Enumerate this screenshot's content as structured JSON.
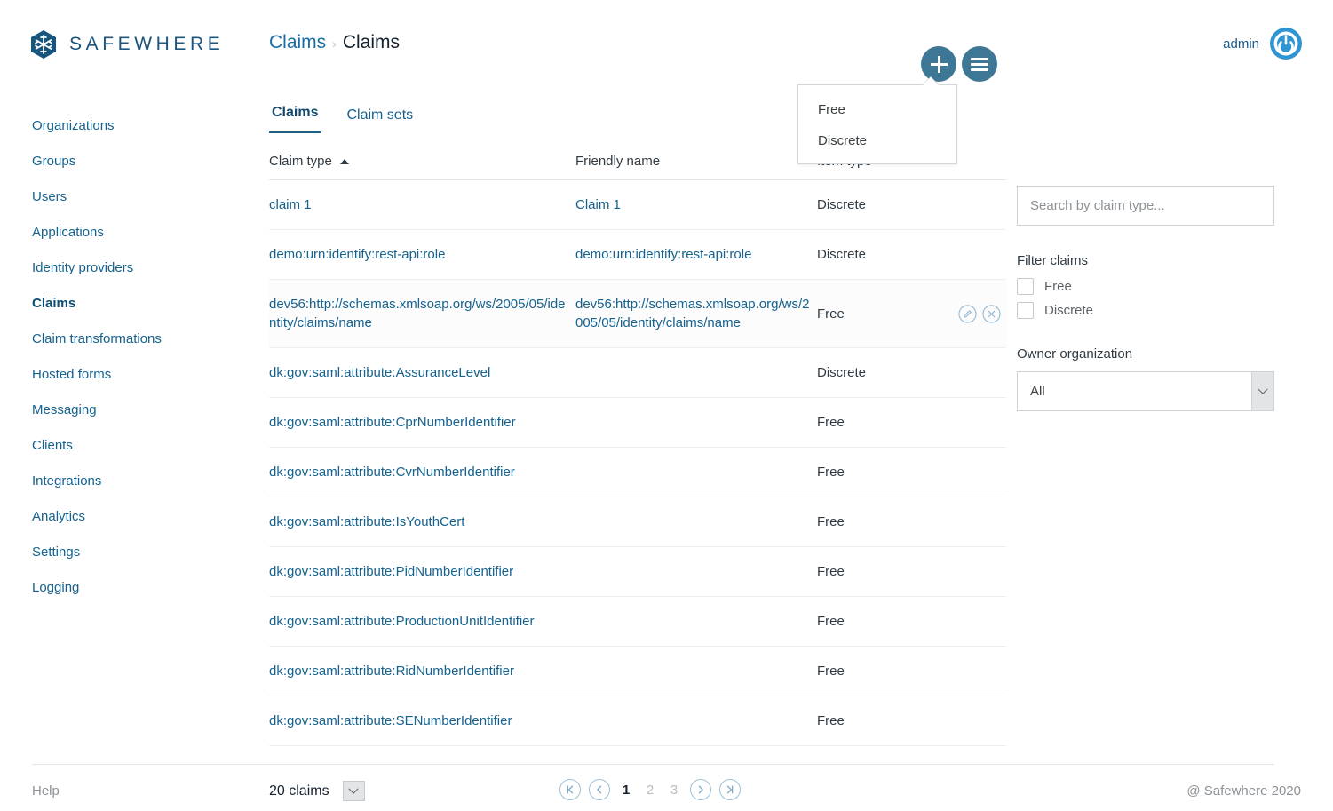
{
  "brand": {
    "name": "SAFEWHERE",
    "logo_icon": "snowflake-hexagon-logo",
    "color": "#1c567f"
  },
  "breadcrumb": {
    "parent": "Claims",
    "separator": "›",
    "current": "Claims"
  },
  "header": {
    "add_button_icon": "plus-icon",
    "menu_button_icon": "hamburger-menu-icon",
    "admin_label": "admin",
    "avatar_icon": "power-avatar-icon"
  },
  "add_menu": {
    "items": [
      {
        "label": "Free"
      },
      {
        "label": "Discrete"
      }
    ]
  },
  "sidebar": {
    "items": [
      {
        "label": "Organizations",
        "active": false
      },
      {
        "label": "Groups",
        "active": false
      },
      {
        "label": "Users",
        "active": false
      },
      {
        "label": "Applications",
        "active": false
      },
      {
        "label": "Identity providers",
        "active": false
      },
      {
        "label": "Claims",
        "active": true
      },
      {
        "label": "Claim transformations",
        "active": false
      },
      {
        "label": "Hosted forms",
        "active": false
      },
      {
        "label": "Messaging",
        "active": false
      },
      {
        "label": "Clients",
        "active": false
      },
      {
        "label": "Integrations",
        "active": false
      },
      {
        "label": "Analytics",
        "active": false
      },
      {
        "label": "Settings",
        "active": false
      },
      {
        "label": "Logging",
        "active": false
      }
    ]
  },
  "tabs": [
    {
      "label": "Claims",
      "active": true
    },
    {
      "label": "Claim sets",
      "active": false
    }
  ],
  "table": {
    "columns": [
      {
        "label": "Claim type",
        "sort": "asc",
        "sort_icon": "sort-ascending-icon"
      },
      {
        "label": "Friendly name"
      },
      {
        "label": "Item type"
      },
      {
        "label": ""
      }
    ],
    "rows": [
      {
        "claim_type": "claim 1",
        "friendly_name": "Claim 1",
        "item_type": "Discrete",
        "hovered": false
      },
      {
        "claim_type": "demo:urn:identify:rest-api:role",
        "friendly_name": "demo:urn:identify:rest-api:role",
        "item_type": "Discrete",
        "hovered": false
      },
      {
        "claim_type": "dev56:http://schemas.xmlsoap.org/ws/2005/05/identity/claims/name",
        "friendly_name": "dev56:http://schemas.xmlsoap.org/ws/2005/05/identity/claims/name",
        "item_type": "Free",
        "hovered": true
      },
      {
        "claim_type": "dk:gov:saml:attribute:AssuranceLevel",
        "friendly_name": "",
        "item_type": "Discrete",
        "hovered": false
      },
      {
        "claim_type": "dk:gov:saml:attribute:CprNumberIdentifier",
        "friendly_name": "",
        "item_type": "Free",
        "hovered": false
      },
      {
        "claim_type": "dk:gov:saml:attribute:CvrNumberIdentifier",
        "friendly_name": "",
        "item_type": "Free",
        "hovered": false
      },
      {
        "claim_type": "dk:gov:saml:attribute:IsYouthCert",
        "friendly_name": "",
        "item_type": "Free",
        "hovered": false
      },
      {
        "claim_type": "dk:gov:saml:attribute:PidNumberIdentifier",
        "friendly_name": "",
        "item_type": "Free",
        "hovered": false
      },
      {
        "claim_type": "dk:gov:saml:attribute:ProductionUnitIdentifier",
        "friendly_name": "",
        "item_type": "Free",
        "hovered": false
      },
      {
        "claim_type": "dk:gov:saml:attribute:RidNumberIdentifier",
        "friendly_name": "",
        "item_type": "Free",
        "hovered": false
      },
      {
        "claim_type": "dk:gov:saml:attribute:SENumberIdentifier",
        "friendly_name": "",
        "item_type": "Free",
        "hovered": false
      }
    ],
    "row_actions": [
      {
        "icon": "edit-pencil-icon"
      },
      {
        "icon": "delete-x-icon"
      }
    ]
  },
  "filters": {
    "search_placeholder": "Search by claim type...",
    "search_value": "",
    "filter_label": "Filter claims",
    "checkboxes": [
      {
        "label": "Free",
        "checked": false
      },
      {
        "label": "Discrete",
        "checked": false
      }
    ],
    "owner_label": "Owner organization",
    "owner_value": "All"
  },
  "footer": {
    "help_label": "Help",
    "copyright": "@ Safewhere 2020",
    "page_size_label": "20 claims",
    "pagination": {
      "first_icon": "go-to-first-page-icon",
      "prev_icon": "previous-page-icon",
      "next_icon": "next-page-icon",
      "last_icon": "go-to-last-page-icon",
      "pages": [
        {
          "label": "1",
          "active": true
        },
        {
          "label": "2",
          "active": false
        },
        {
          "label": "3",
          "active": false
        }
      ]
    }
  }
}
